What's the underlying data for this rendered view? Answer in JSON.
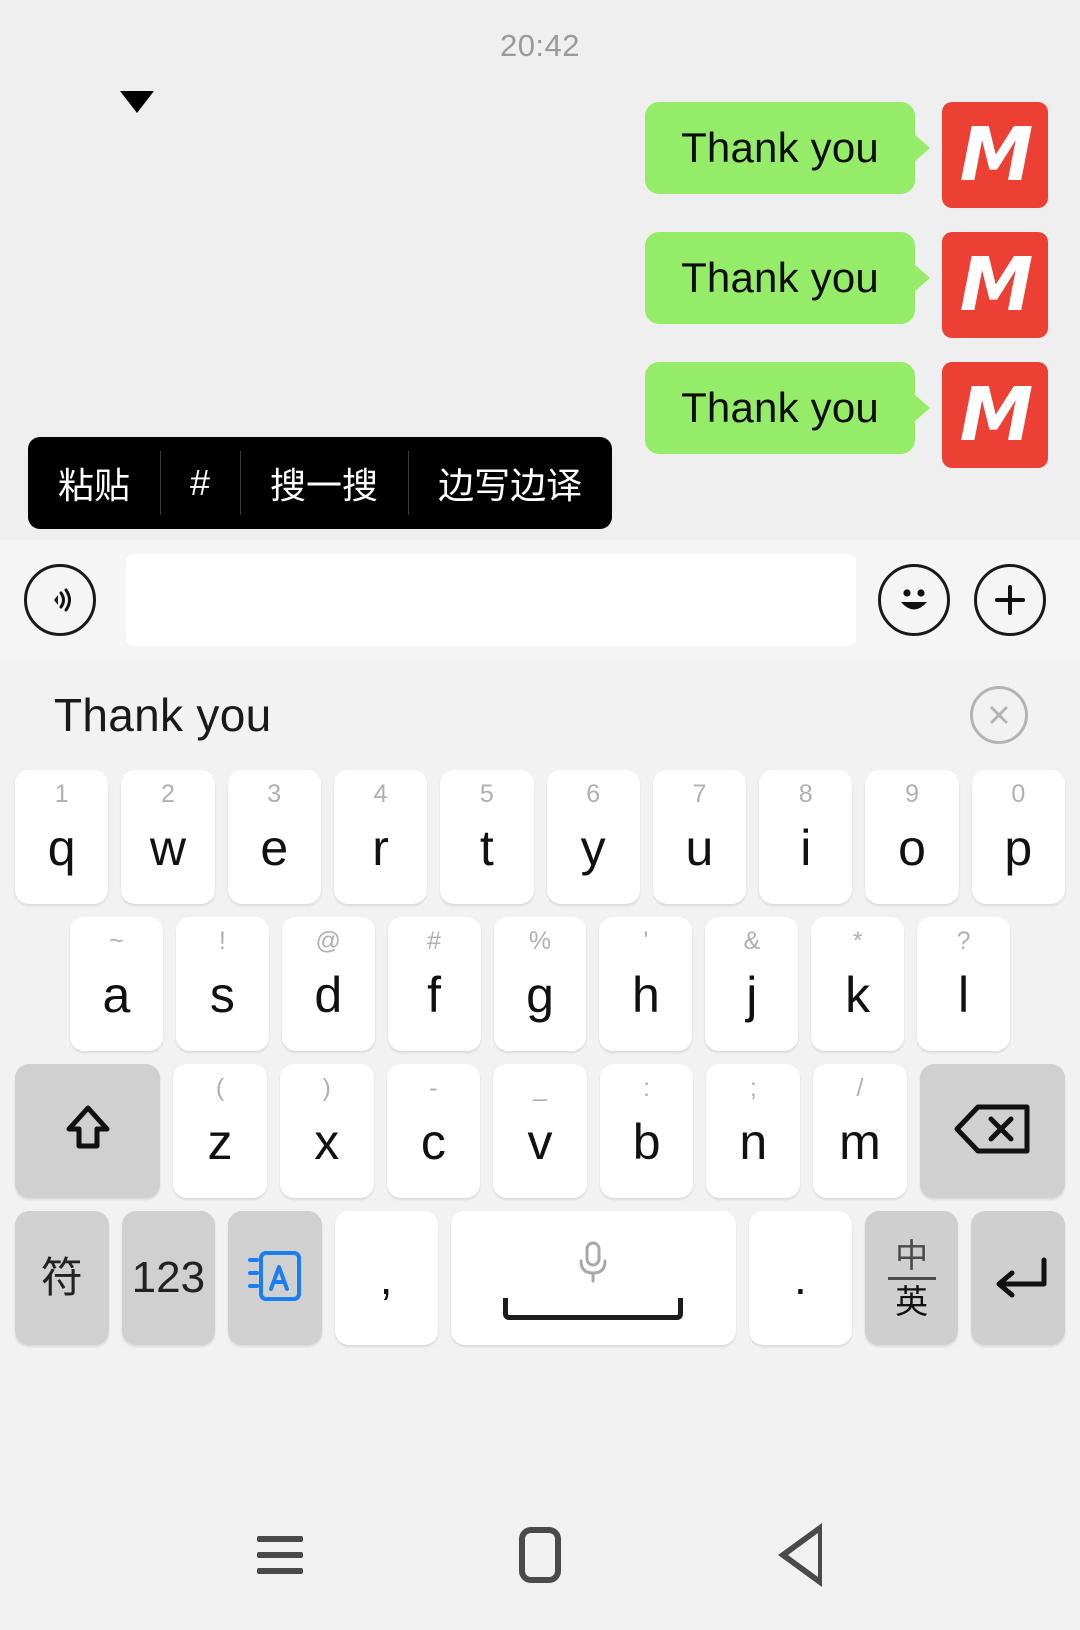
{
  "chat": {
    "timestamp": "20:42",
    "messages": [
      {
        "text": "Thank you",
        "avatar_letter": "M",
        "avatar_color": "#ec4034",
        "bubble_color": "#95ec69"
      },
      {
        "text": "Thank you",
        "avatar_letter": "M",
        "avatar_color": "#ec4034",
        "bubble_color": "#95ec69"
      },
      {
        "text": "Thank you",
        "avatar_letter": "M",
        "avatar_color": "#ec4034",
        "bubble_color": "#95ec69"
      }
    ]
  },
  "context_menu": {
    "items": [
      {
        "label": "粘贴",
        "name": "paste"
      },
      {
        "label": "#",
        "name": "hash"
      },
      {
        "label": "搜一搜",
        "name": "search"
      },
      {
        "label": "边写边译",
        "name": "translate-while-typing"
      }
    ]
  },
  "input_bar": {
    "voice_icon": "voice-wave-icon",
    "text_value": "",
    "placeholder": "",
    "emoji_icon": "smiley-icon",
    "plus_icon": "plus-icon"
  },
  "keyboard": {
    "candidate": {
      "text": "Thank you",
      "close_icon": "close-circle-icon"
    },
    "row1": [
      {
        "alt": "1",
        "main": "q"
      },
      {
        "alt": "2",
        "main": "w"
      },
      {
        "alt": "3",
        "main": "e"
      },
      {
        "alt": "4",
        "main": "r"
      },
      {
        "alt": "5",
        "main": "t"
      },
      {
        "alt": "6",
        "main": "y"
      },
      {
        "alt": "7",
        "main": "u"
      },
      {
        "alt": "8",
        "main": "i"
      },
      {
        "alt": "9",
        "main": "o"
      },
      {
        "alt": "0",
        "main": "p"
      }
    ],
    "row2": [
      {
        "alt": "~",
        "main": "a"
      },
      {
        "alt": "!",
        "main": "s"
      },
      {
        "alt": "@",
        "main": "d"
      },
      {
        "alt": "#",
        "main": "f"
      },
      {
        "alt": "%",
        "main": "g"
      },
      {
        "alt": "'",
        "main": "h"
      },
      {
        "alt": "&",
        "main": "j"
      },
      {
        "alt": "*",
        "main": "k"
      },
      {
        "alt": "?",
        "main": "l"
      }
    ],
    "row3": {
      "shift_icon": "shift-arrow-icon",
      "keys": [
        {
          "alt": "(",
          "main": "z"
        },
        {
          "alt": ")",
          "main": "x"
        },
        {
          "alt": "-",
          "main": "c"
        },
        {
          "alt": "_",
          "main": "v"
        },
        {
          "alt": ":",
          "main": "b"
        },
        {
          "alt": ";",
          "main": "n"
        },
        {
          "alt": "/",
          "main": "m"
        }
      ],
      "backspace_icon": "backspace-icon"
    },
    "row4": {
      "symbol_label": "符",
      "numeric_label": "123",
      "translate_icon": "translate-a-icon",
      "comma_label": ",",
      "space_icon": "microphone-icon",
      "period_label": ".",
      "lang_top": "中",
      "lang_bottom": "英",
      "enter_icon": "enter-return-icon"
    }
  },
  "navbar": {
    "recents_icon": "hamburger-recents-icon",
    "home_icon": "home-square-icon",
    "back_icon": "back-triangle-icon"
  }
}
